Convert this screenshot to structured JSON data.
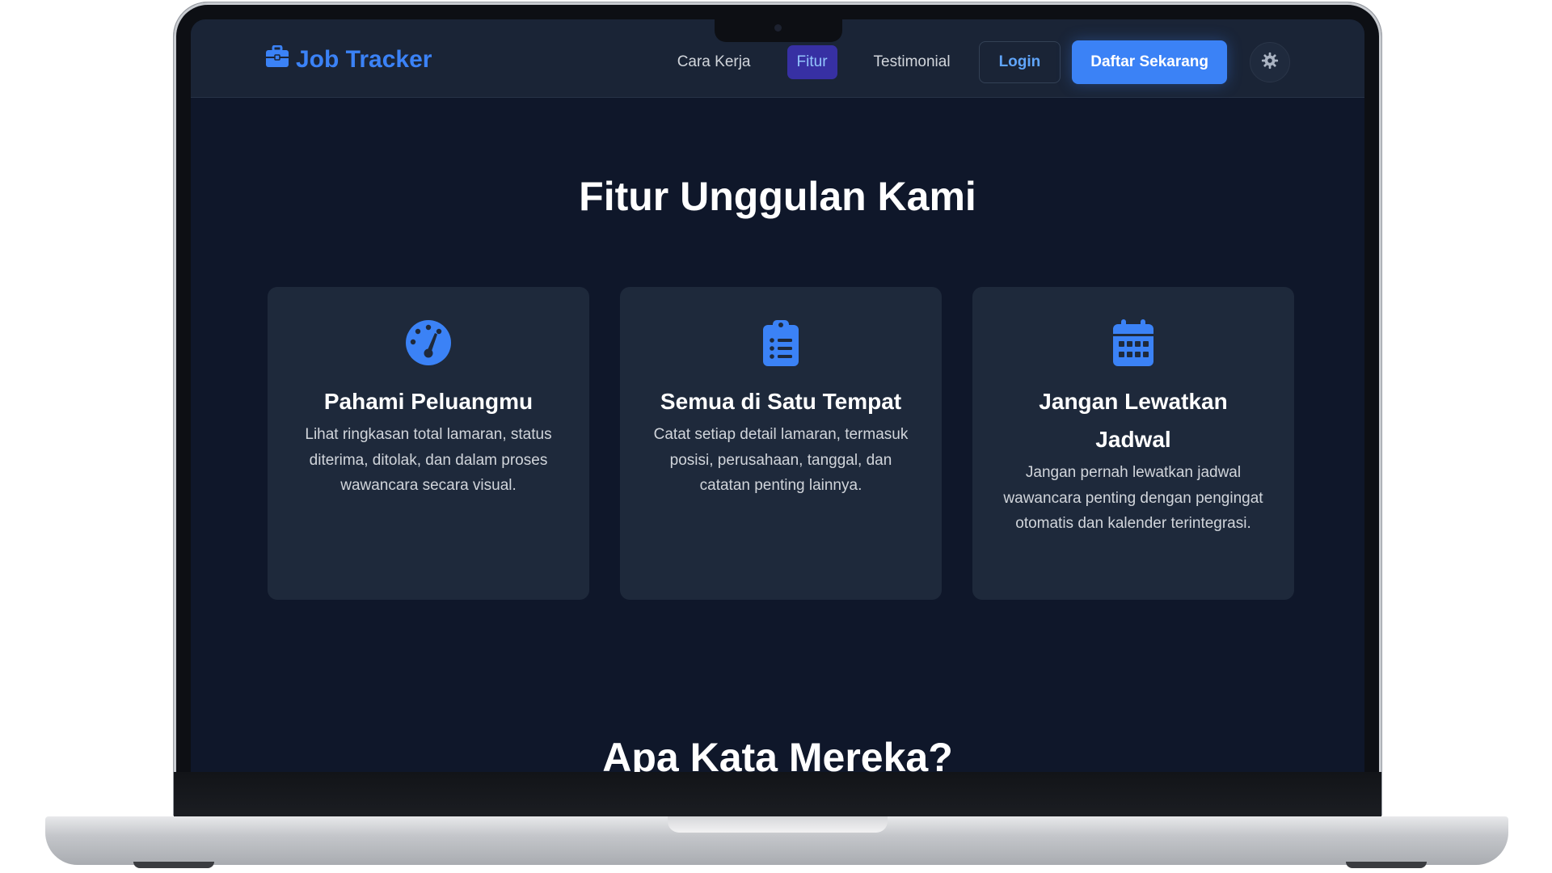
{
  "brand": {
    "name": "Job Tracker",
    "icon": "briefcase-icon",
    "color": "#3b82f6"
  },
  "nav": {
    "links": [
      {
        "label": "Cara Kerja",
        "active": false
      },
      {
        "label": "Fitur",
        "active": true
      },
      {
        "label": "Testimonial",
        "active": false
      }
    ],
    "login_label": "Login",
    "signup_label": "Daftar Sekarang",
    "settings_icon": "gear-icon"
  },
  "features": {
    "title": "Fitur Unggulan Kami",
    "cards": [
      {
        "icon": "gauge-icon",
        "title": "Pahami Peluangmu",
        "description": "Lihat ringkasan total lamaran, status diterima, ditolak, dan dalam proses wawancara secara visual."
      },
      {
        "icon": "clipboard-list-icon",
        "title": "Semua di Satu Tempat",
        "description": "Catat setiap detail lamaran, termasuk posisi, perusahaan, tanggal, dan catatan penting lainnya."
      },
      {
        "icon": "calendar-icon",
        "title": "Jangan Lewatkan Jadwal",
        "description": "Jangan pernah lewatkan jadwal wawancara penting dengan pengingat otomatis dan kalender terintegrasi."
      }
    ]
  },
  "testimonials": {
    "title": "Apa Kata Mereka?"
  },
  "colors": {
    "accent": "#3b82f6",
    "page_bg": "#0f172a",
    "card_bg": "#1e293b",
    "nav_bg": "#1a2436"
  }
}
